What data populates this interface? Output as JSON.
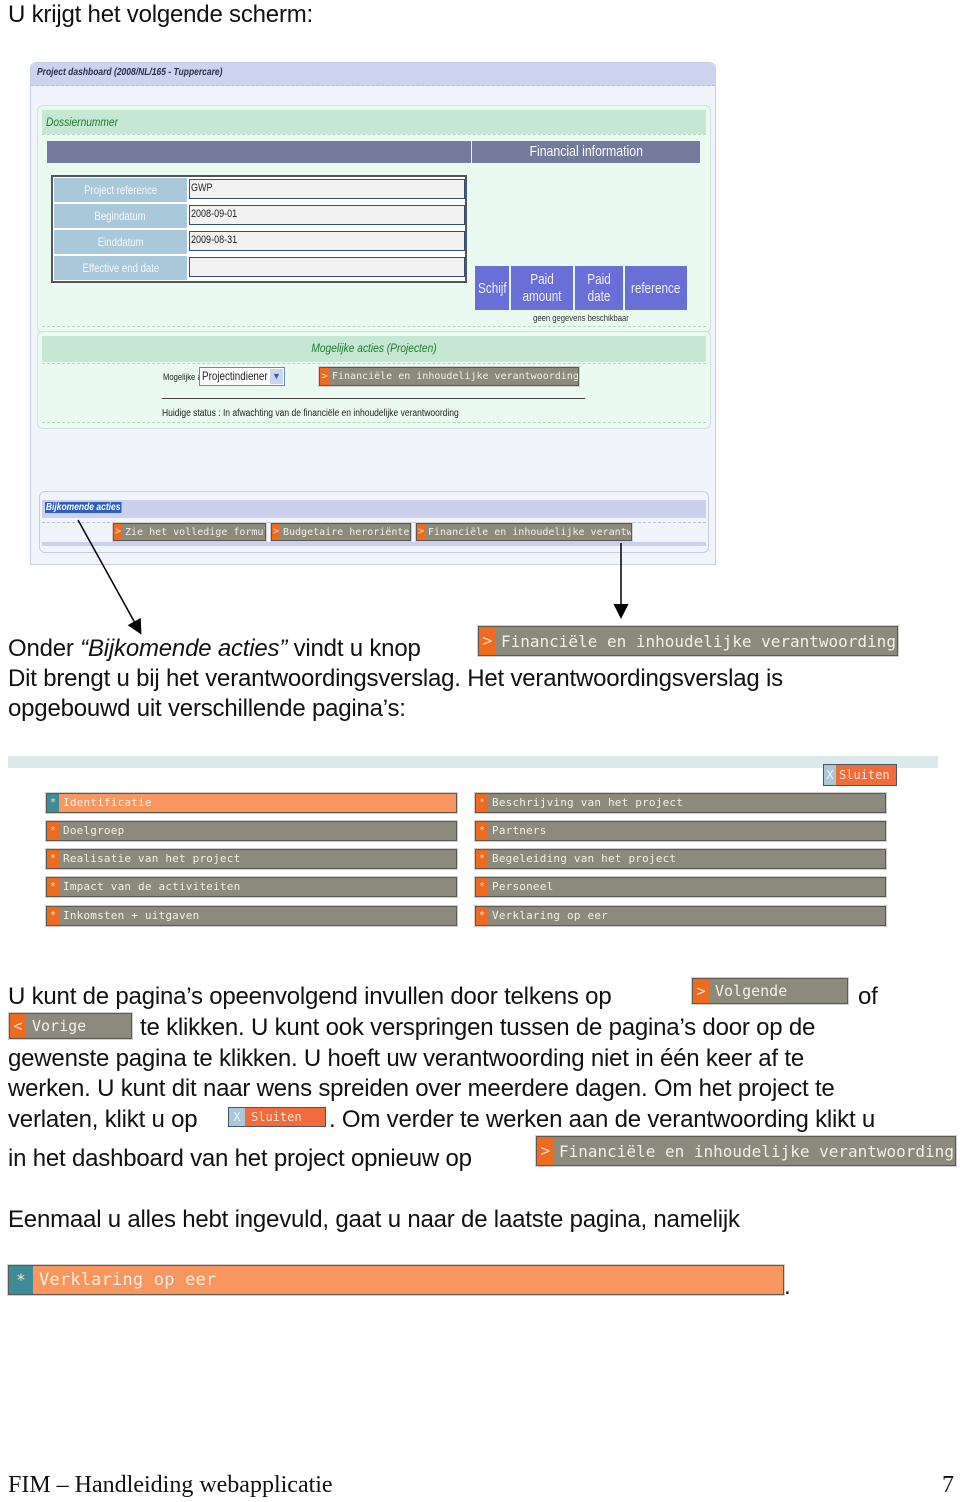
{
  "intro": "U krijgt het volgende scherm:",
  "dashboard": {
    "title": "Project dashboard (2008/NL/165 - Tuppercare)",
    "dossier_header": "Dossiernummer",
    "financial_header": "Financial information",
    "fields": [
      {
        "label": "Project reference",
        "value": "GWP"
      },
      {
        "label": "Begindatum",
        "value": "2008-09-01"
      },
      {
        "label": "Einddatum",
        "value": "2009-08-31"
      },
      {
        "label": "Effective end date",
        "value": ""
      }
    ],
    "financial_columns": [
      "Schijf",
      "Paid amount",
      "Paid date",
      "reference"
    ],
    "financial_empty": "geen gegevens beschikbaar",
    "actions_header": "Mogelijke acties (Projecten)",
    "actions_label": "Mogelijke acties",
    "role_select": {
      "selected": "Projectindiener"
    },
    "submit_button": {
      "marker": ">",
      "label": "Financiële en inhoudelijke verantwoording indienen"
    },
    "status": "Huidige status : In afwachting van de financiële en inhoudelijke verantwoording",
    "extra_header": "Bijkomende acties",
    "extra_buttons": [
      {
        "marker": ">",
        "label": "Zie het volledige formulier"
      },
      {
        "marker": ">",
        "label": "Budgetaire heroriëntering"
      },
      {
        "marker": ">",
        "label": "Financiële en inhoudelijke verantwoording"
      }
    ]
  },
  "para1": {
    "line1_prefix": "Onder ",
    "line1_italic": "“Bijkomende acties”",
    "line1_suffix": " vindt u knop",
    "button": {
      "marker": ">",
      "label": "Financiële en inhoudelijke verantwoording"
    },
    "line2": "Dit brengt u bij het verantwoordingsverslag. Het verantwoordingsverslag is",
    "line3": "opgebouwd uit verschillende pagina’s:"
  },
  "report_pages": {
    "close_button": {
      "marker": "X",
      "label": "Sluiten"
    },
    "left": [
      {
        "marker": "*",
        "label": "Identificatie",
        "active": true
      },
      {
        "marker": "*",
        "label": "Doelgroep"
      },
      {
        "marker": "*",
        "label": "Realisatie van het project"
      },
      {
        "marker": "*",
        "label": "Impact van de activiteiten"
      },
      {
        "marker": "*",
        "label": "Inkomsten + uitgaven"
      }
    ],
    "right": [
      {
        "marker": "*",
        "label": "Beschrijving van het project"
      },
      {
        "marker": "*",
        "label": "Partners"
      },
      {
        "marker": "*",
        "label": "Begeleiding van het project"
      },
      {
        "marker": "*",
        "label": "Personeel"
      },
      {
        "marker": "*",
        "label": "Verklaring op eer"
      }
    ]
  },
  "para2": {
    "l1_a": "U kunt de pagina’s opeenvolgend invullen door telkens op",
    "next_button": {
      "marker": ">",
      "label": "Volgende"
    },
    "l1_b": "of",
    "prev_button": {
      "marker": "<",
      "label": "Vorige"
    },
    "l2": "te klikken. U kunt ook verspringen tussen de pagina’s door op de",
    "l3": "gewenste pagina te klikken. U hoeft uw verantwoording niet in één keer af te",
    "l4": "werken. U kunt dit naar wens spreiden over meerdere dagen. Om het project te",
    "l5_a": "verlaten, klikt u op",
    "close_button": {
      "marker": "X",
      "label": "Sluiten"
    },
    "l5_b": ". Om verder te werken aan de verantwoording klikt u",
    "l6": "in het dashboard van het project opnieuw op",
    "button": {
      "marker": ">",
      "label": "Financiële en inhoudelijke verantwoording"
    }
  },
  "para3": {
    "text": "Eenmaal u alles hebt ingevuld, gaat u naar de laatste pagina, namelijk",
    "button": {
      "marker": "*",
      "label": "Verklaring op eer"
    },
    "trailing": "."
  },
  "footer": {
    "title": "FIM – Handleiding webapplicatie",
    "page": "7"
  }
}
